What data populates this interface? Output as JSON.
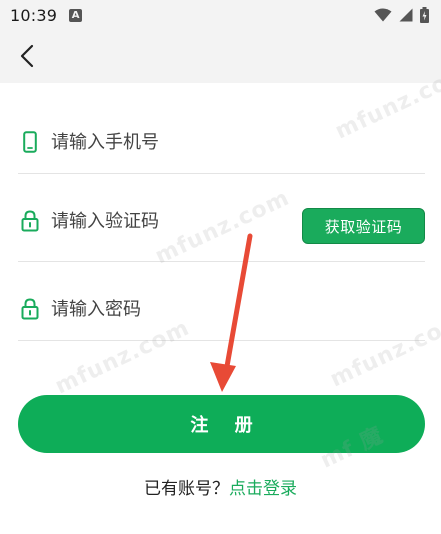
{
  "status_bar": {
    "time": "10:39",
    "notification_glyph": "A"
  },
  "form": {
    "phone_placeholder": "请输入手机号",
    "code_placeholder": "请输入验证码",
    "password_placeholder": "请输入密码",
    "get_code_label": "获取验证码"
  },
  "register_label": "注 册",
  "login_prompt": {
    "text": "已有账号？",
    "link": "点击登录"
  },
  "watermarks": [
    "mfunz.com",
    "mfunz.com",
    "mfunz.com",
    "mfunz.com",
    "mf 魔"
  ],
  "colors": {
    "accent": "#1aab5c",
    "button": "#0ead58",
    "arrow": "#e84a36"
  }
}
